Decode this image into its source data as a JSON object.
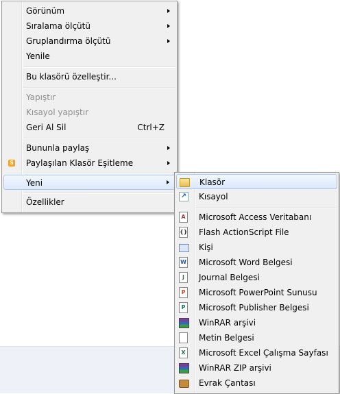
{
  "context_menu": {
    "items": [
      {
        "label": "Görünüm"
      },
      {
        "label": "Sıralama ölçütü"
      },
      {
        "label": "Gruplandırma ölçütü"
      },
      {
        "label": "Yenile"
      },
      {
        "label": "Bu klasörü özelleştir..."
      },
      {
        "label": "Yapıştır"
      },
      {
        "label": "Kısayol yapıştır"
      },
      {
        "label": "Geri Al Sil",
        "shortcut": "Ctrl+Z"
      },
      {
        "label": "Bununla paylaş"
      },
      {
        "label": "Paylaşılan Klasör Eşitleme",
        "icon": "sync-folder-icon"
      },
      {
        "label": "Yeni"
      },
      {
        "label": "Özellikler"
      }
    ]
  },
  "new_submenu": {
    "items": [
      {
        "label": "Klasör",
        "icon": "folder-icon"
      },
      {
        "label": "Kısayol",
        "icon": "shortcut-icon"
      },
      {
        "label": "Microsoft Access Veritabanı",
        "icon": "access-icon"
      },
      {
        "label": "Flash ActionScript File",
        "icon": "actionscript-icon"
      },
      {
        "label": "Kişi",
        "icon": "contact-icon"
      },
      {
        "label": "Microsoft Word Belgesi",
        "icon": "word-icon"
      },
      {
        "label": "Journal Belgesi",
        "icon": "journal-icon"
      },
      {
        "label": "Microsoft PowerPoint Sunusu",
        "icon": "powerpoint-icon"
      },
      {
        "label": "Microsoft Publisher Belgesi",
        "icon": "publisher-icon"
      },
      {
        "label": "WinRAR arşivi",
        "icon": "winrar-icon"
      },
      {
        "label": "Metin Belgesi",
        "icon": "text-document-icon"
      },
      {
        "label": "Microsoft Excel Çalışma Sayfası",
        "icon": "excel-icon"
      },
      {
        "label": "WinRAR ZIP arşivi",
        "icon": "winrar-zip-icon"
      },
      {
        "label": "Evrak Çantası",
        "icon": "briefcase-icon"
      }
    ]
  }
}
